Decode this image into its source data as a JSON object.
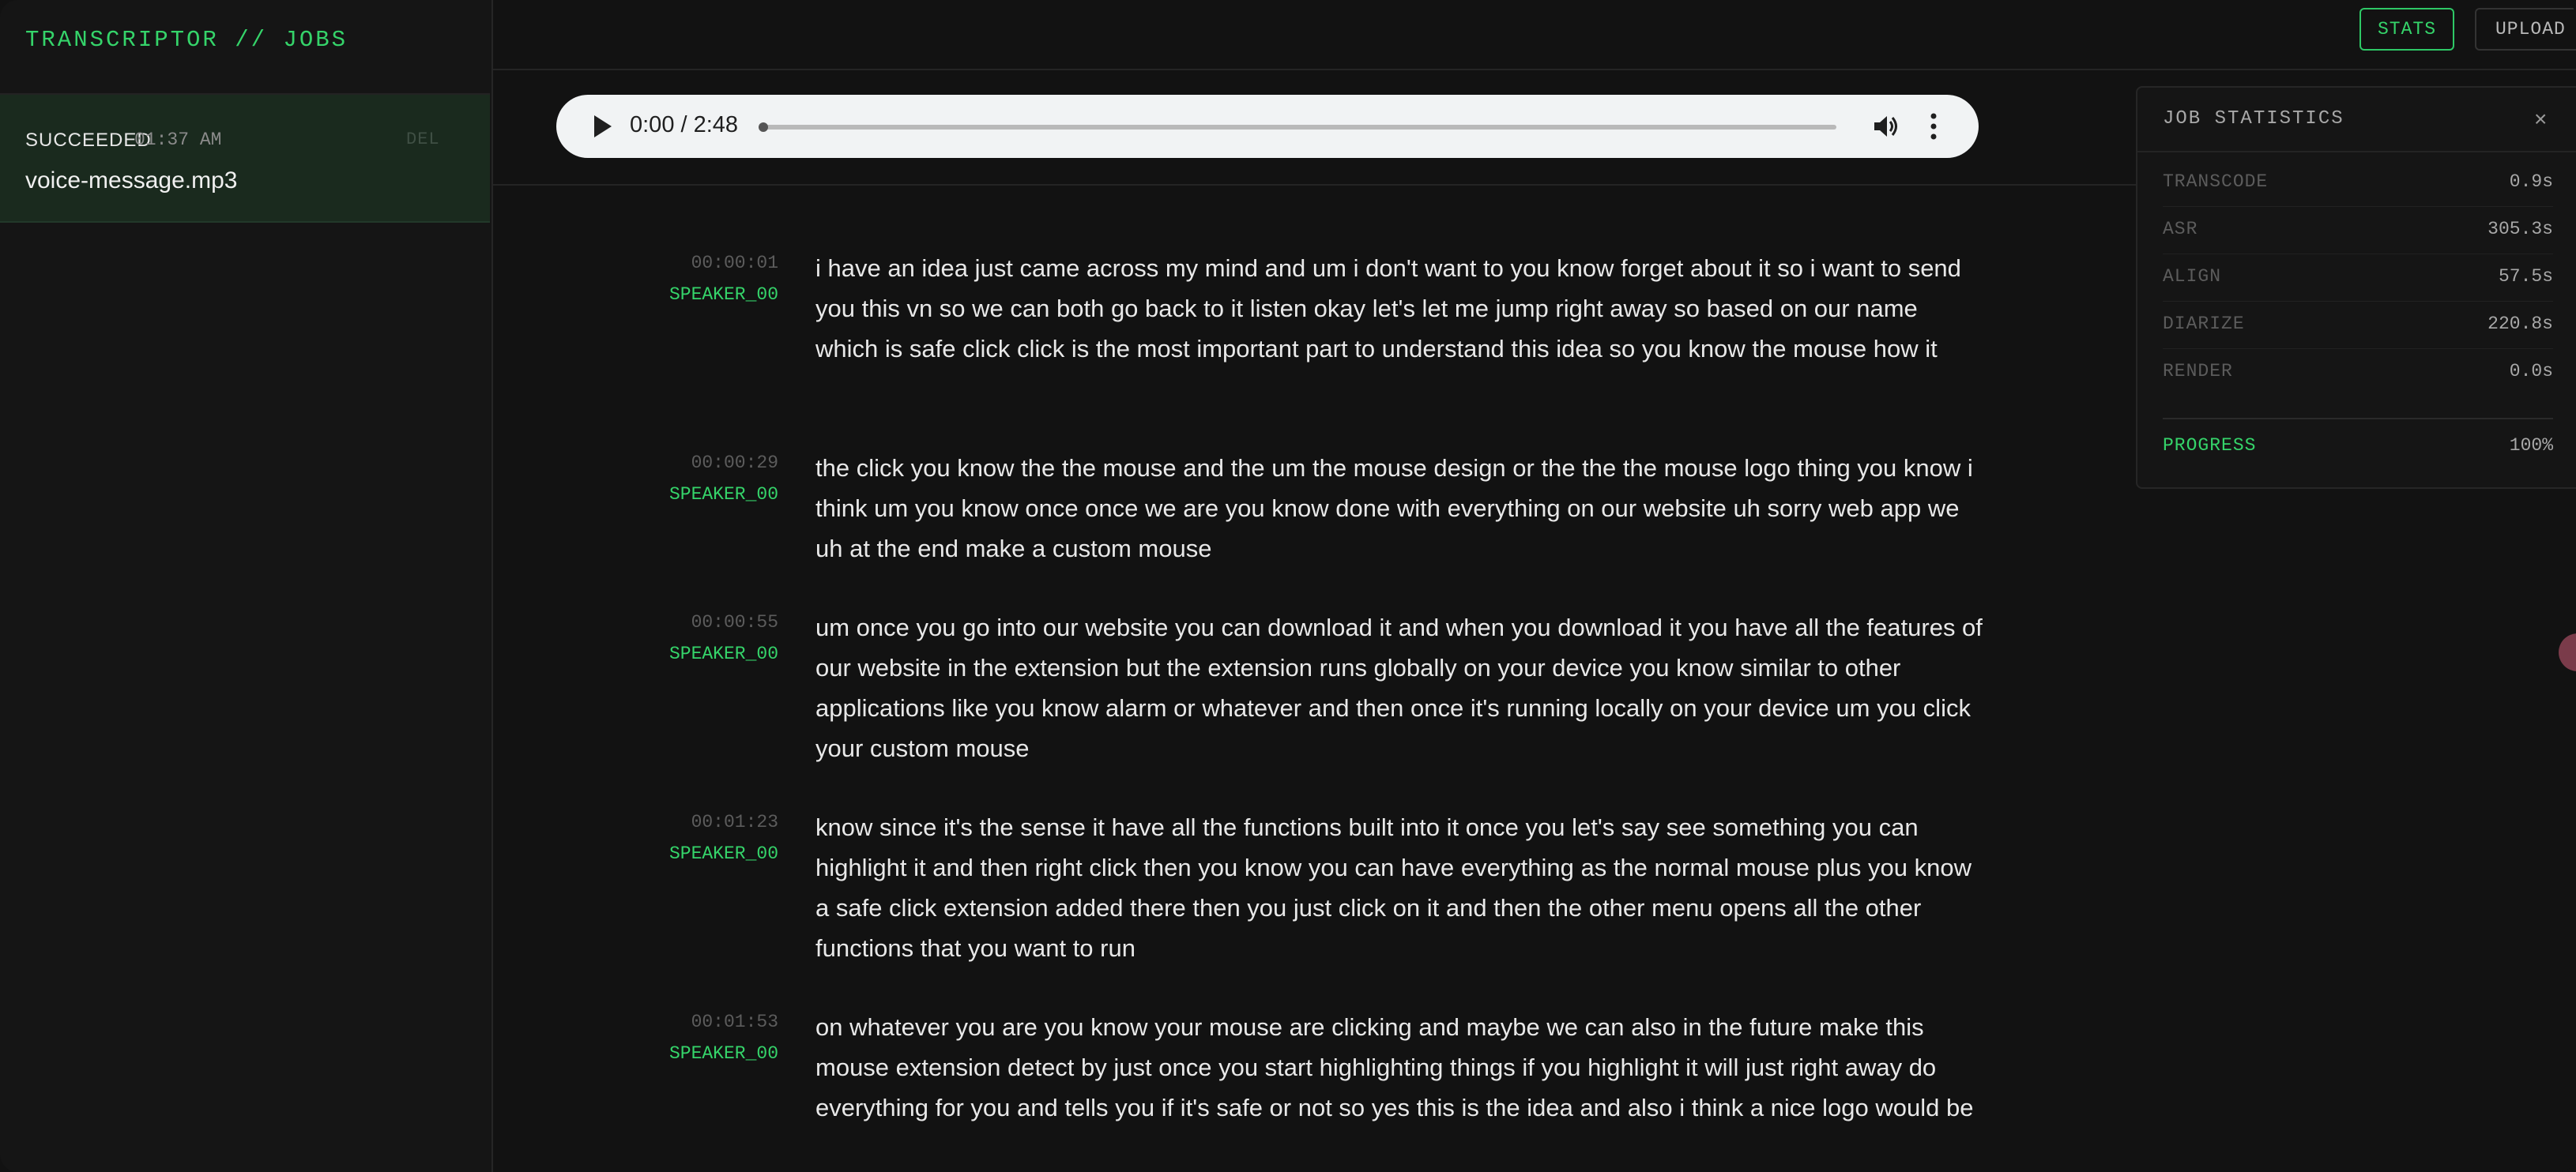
{
  "sidebar": {
    "title": "TRANSCRIPTOR // JOBS",
    "jobs": [
      {
        "status": "SUCCEEDED",
        "time": "01:37 AM",
        "delete_label": "DEL",
        "filename": "voice-message.mp3"
      }
    ]
  },
  "toolbar": {
    "stats_label": "STATS",
    "upload_label": "UPLOAD"
  },
  "player": {
    "time_display": "0:00 / 2:48",
    "progress": 0
  },
  "transcript": [
    {
      "time": "00:00:01",
      "speaker": "SPEAKER_00",
      "text": "i have an idea just came across my mind and um i don't want to you know forget about it so i want to send you this vn so we can both go back to it listen okay let's let me jump right away so based on our name which is safe click click is the most important part to understand this idea so you know the mouse how it"
    },
    {
      "time": "00:00:29",
      "speaker": "SPEAKER_00",
      "text": "the click you know the the mouse and the um the mouse design or the the the mouse logo thing you know i think um you know once once we are you know done with everything on our website uh sorry web app we uh at the end make a custom mouse"
    },
    {
      "time": "00:00:55",
      "speaker": "SPEAKER_00",
      "text": "um once you go into our website you can download it and when you download it you have all the features of our website in the extension but the extension runs globally on your device you know similar to other applications like you know alarm or whatever and then once it's running locally on your device um you click your custom mouse"
    },
    {
      "time": "00:01:23",
      "speaker": "SPEAKER_00",
      "text": "know since it's the sense it have all the functions built into it once you let's say see something you can highlight it and then right click then you know you can have everything as the normal mouse plus you know a safe click extension added there then you just click on it and then the other menu opens all the other functions that you want to run"
    },
    {
      "time": "00:01:53",
      "speaker": "SPEAKER_00",
      "text": "on whatever you are you know your mouse are clicking and maybe we can also in the future make this mouse extension detect by just once you start highlighting things if you highlight it will just right away do everything for you and tells you if it's safe or not so yes this is the idea and also i think a nice logo would be"
    }
  ],
  "stats": {
    "title": "JOB STATISTICS",
    "close_label": "×",
    "rows": [
      {
        "label": "TRANSCODE",
        "value": "0.9s"
      },
      {
        "label": "ASR",
        "value": "305.3s"
      },
      {
        "label": "ALIGN",
        "value": "57.5s"
      },
      {
        "label": "DIARIZE",
        "value": "220.8s"
      },
      {
        "label": "RENDER",
        "value": "0.0s"
      }
    ],
    "progress_label": "PROGRESS",
    "progress_value": "100%"
  },
  "colors": {
    "accent": "#35d46a",
    "background": "#121212",
    "sidebar_selected": "#1a2a1e"
  }
}
